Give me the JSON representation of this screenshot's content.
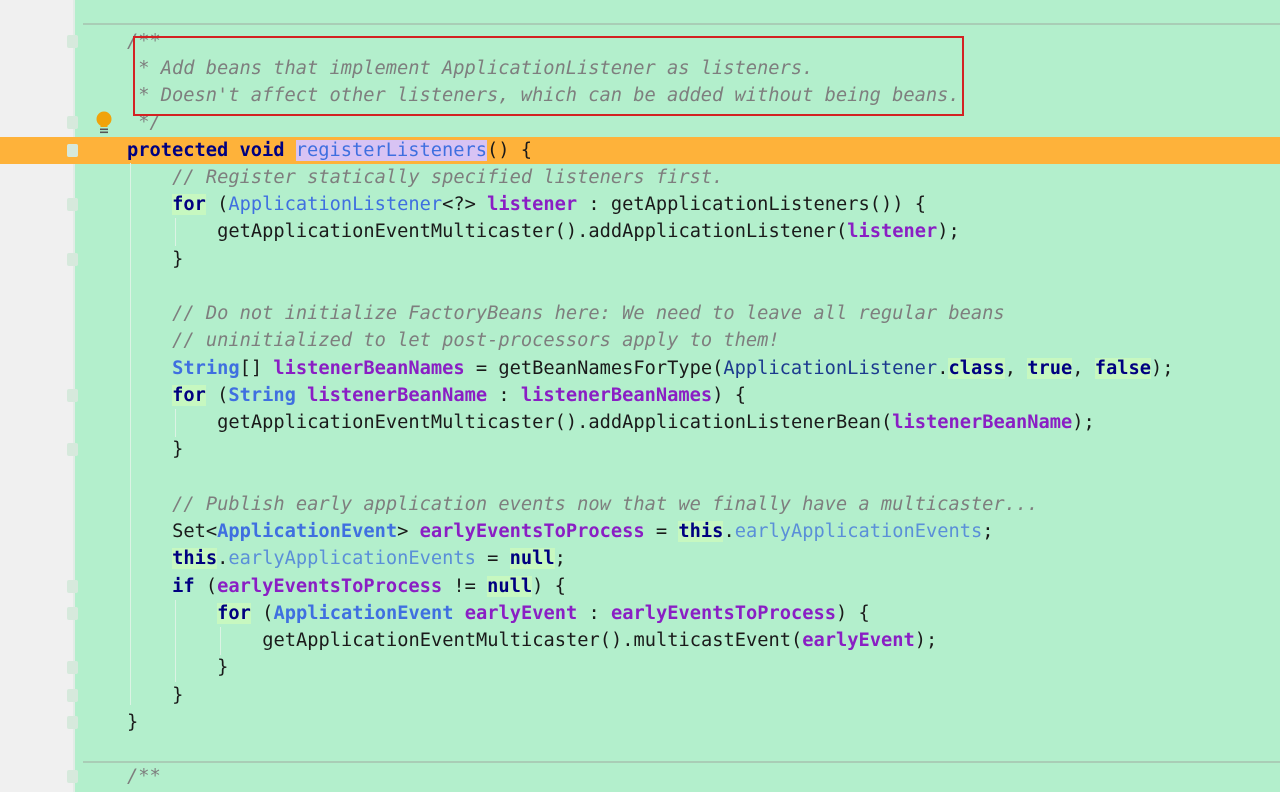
{
  "editor": {
    "colors": {
      "background": "#b3efcc",
      "current_line": "#feb23a",
      "annotation_box": "#d32222"
    },
    "gutter_icons": [
      "lightbulb-icon",
      "fold-marker-icon"
    ],
    "lines": [
      {
        "indent": 0,
        "tokens": [
          {
            "t": "/**",
            "c": "cm"
          }
        ]
      },
      {
        "indent": 0,
        "pad": 1,
        "tokens": [
          {
            "t": "* Add beans that implement ApplicationListener as listeners.",
            "c": "cm"
          }
        ]
      },
      {
        "indent": 0,
        "pad": 1,
        "tokens": [
          {
            "t": "* Doesn't affect other listeners, which can be added without being beans.",
            "c": "cm"
          }
        ]
      },
      {
        "indent": 0,
        "pad": 1,
        "tokens": [
          {
            "t": "*/",
            "c": "cm"
          }
        ]
      },
      {
        "indent": 0,
        "current": true,
        "tokens": [
          {
            "t": "protected void ",
            "c": "kw"
          },
          {
            "t": "registerListeners",
            "c": "meth"
          },
          {
            "t": "() {",
            "c": "pl"
          }
        ]
      },
      {
        "indent": 1,
        "tokens": [
          {
            "t": "// Register statically specified listeners first.",
            "c": "cm"
          }
        ]
      },
      {
        "indent": 1,
        "tokens": [
          {
            "t": "for",
            "c": "kw hl"
          },
          {
            "t": " (",
            "c": "pl"
          },
          {
            "t": "ApplicationListener",
            "c": "ty"
          },
          {
            "t": "<?> ",
            "c": "pl"
          },
          {
            "t": "listener",
            "c": "var"
          },
          {
            "t": " : getApplicationListeners()) {",
            "c": "pl"
          }
        ]
      },
      {
        "indent": 2,
        "tokens": [
          {
            "t": "getApplicationEventMulticaster().addApplicationListener(",
            "c": "pl"
          },
          {
            "t": "listener",
            "c": "var"
          },
          {
            "t": ");",
            "c": "pl"
          }
        ]
      },
      {
        "indent": 1,
        "tokens": [
          {
            "t": "}",
            "c": "pl"
          }
        ]
      },
      {
        "indent": 0,
        "tokens": []
      },
      {
        "indent": 1,
        "tokens": [
          {
            "t": "// Do not initialize FactoryBeans here: We need to leave all regular beans",
            "c": "cm"
          }
        ]
      },
      {
        "indent": 1,
        "tokens": [
          {
            "t": "// uninitialized to let post-processors apply to them!",
            "c": "cm"
          }
        ]
      },
      {
        "indent": 1,
        "tokens": [
          {
            "t": "String",
            "c": "tyb"
          },
          {
            "t": "[] ",
            "c": "pl"
          },
          {
            "t": "listenerBeanNames",
            "c": "var"
          },
          {
            "t": " = getBeanNamesForType(",
            "c": "pl"
          },
          {
            "t": "ApplicationListener",
            "c": "tyd"
          },
          {
            "t": ".",
            "c": "pl"
          },
          {
            "t": "class",
            "c": "kw hl"
          },
          {
            "t": ", ",
            "c": "pl"
          },
          {
            "t": "true",
            "c": "kw hl"
          },
          {
            "t": ", ",
            "c": "pl"
          },
          {
            "t": "false",
            "c": "kw hl"
          },
          {
            "t": ");",
            "c": "pl"
          }
        ]
      },
      {
        "indent": 1,
        "tokens": [
          {
            "t": "for",
            "c": "kw hl"
          },
          {
            "t": " (",
            "c": "pl"
          },
          {
            "t": "String",
            "c": "tyb"
          },
          {
            "t": " ",
            "c": "pl"
          },
          {
            "t": "listenerBeanName",
            "c": "var"
          },
          {
            "t": " : ",
            "c": "pl"
          },
          {
            "t": "listenerBeanNames",
            "c": "var"
          },
          {
            "t": ") {",
            "c": "pl"
          }
        ]
      },
      {
        "indent": 2,
        "tokens": [
          {
            "t": "getApplicationEventMulticaster().addApplicationListenerBean(",
            "c": "pl"
          },
          {
            "t": "listenerBeanName",
            "c": "var"
          },
          {
            "t": ");",
            "c": "pl"
          }
        ]
      },
      {
        "indent": 1,
        "tokens": [
          {
            "t": "}",
            "c": "pl"
          }
        ]
      },
      {
        "indent": 0,
        "tokens": []
      },
      {
        "indent": 1,
        "tokens": [
          {
            "t": "// Publish early application events now that we finally have a multicaster...",
            "c": "cm"
          }
        ]
      },
      {
        "indent": 1,
        "tokens": [
          {
            "t": "Set<",
            "c": "pl"
          },
          {
            "t": "ApplicationEvent",
            "c": "tyb"
          },
          {
            "t": "> ",
            "c": "pl"
          },
          {
            "t": "earlyEventsToProcess",
            "c": "var"
          },
          {
            "t": " = ",
            "c": "pl"
          },
          {
            "t": "this",
            "c": "kw hl"
          },
          {
            "t": ".",
            "c": "pl"
          },
          {
            "t": "earlyApplicationEvents",
            "c": "fld"
          },
          {
            "t": ";",
            "c": "pl"
          }
        ]
      },
      {
        "indent": 1,
        "tokens": [
          {
            "t": "this",
            "c": "kw hl"
          },
          {
            "t": ".",
            "c": "pl"
          },
          {
            "t": "earlyApplicationEvents",
            "c": "fld"
          },
          {
            "t": " = ",
            "c": "pl"
          },
          {
            "t": "null",
            "c": "kw hl"
          },
          {
            "t": ";",
            "c": "pl"
          }
        ]
      },
      {
        "indent": 1,
        "tokens": [
          {
            "t": "if",
            "c": "kw"
          },
          {
            "t": " (",
            "c": "pl"
          },
          {
            "t": "earlyEventsToProcess",
            "c": "var"
          },
          {
            "t": " != ",
            "c": "pl"
          },
          {
            "t": "null",
            "c": "kw hl"
          },
          {
            "t": ") {",
            "c": "pl"
          }
        ]
      },
      {
        "indent": 2,
        "tokens": [
          {
            "t": "for",
            "c": "kw hl"
          },
          {
            "t": " (",
            "c": "pl"
          },
          {
            "t": "ApplicationEvent",
            "c": "tyb"
          },
          {
            "t": " ",
            "c": "pl"
          },
          {
            "t": "earlyEvent",
            "c": "var"
          },
          {
            "t": " : ",
            "c": "pl"
          },
          {
            "t": "earlyEventsToProcess",
            "c": "var"
          },
          {
            "t": ") {",
            "c": "pl"
          }
        ]
      },
      {
        "indent": 3,
        "tokens": [
          {
            "t": "getApplicationEventMulticaster().multicastEvent(",
            "c": "pl"
          },
          {
            "t": "earlyEvent",
            "c": "var"
          },
          {
            "t": ");",
            "c": "pl"
          }
        ]
      },
      {
        "indent": 2,
        "tokens": [
          {
            "t": "}",
            "c": "pl"
          }
        ]
      },
      {
        "indent": 1,
        "tokens": [
          {
            "t": "}",
            "c": "pl"
          }
        ]
      },
      {
        "indent": 0,
        "tokens": [
          {
            "t": "}",
            "c": "pl"
          }
        ]
      },
      {
        "indent": 0,
        "tokens": []
      },
      {
        "indent": 0,
        "tokens": [
          {
            "t": "/**",
            "c": "cm"
          }
        ]
      }
    ]
  }
}
